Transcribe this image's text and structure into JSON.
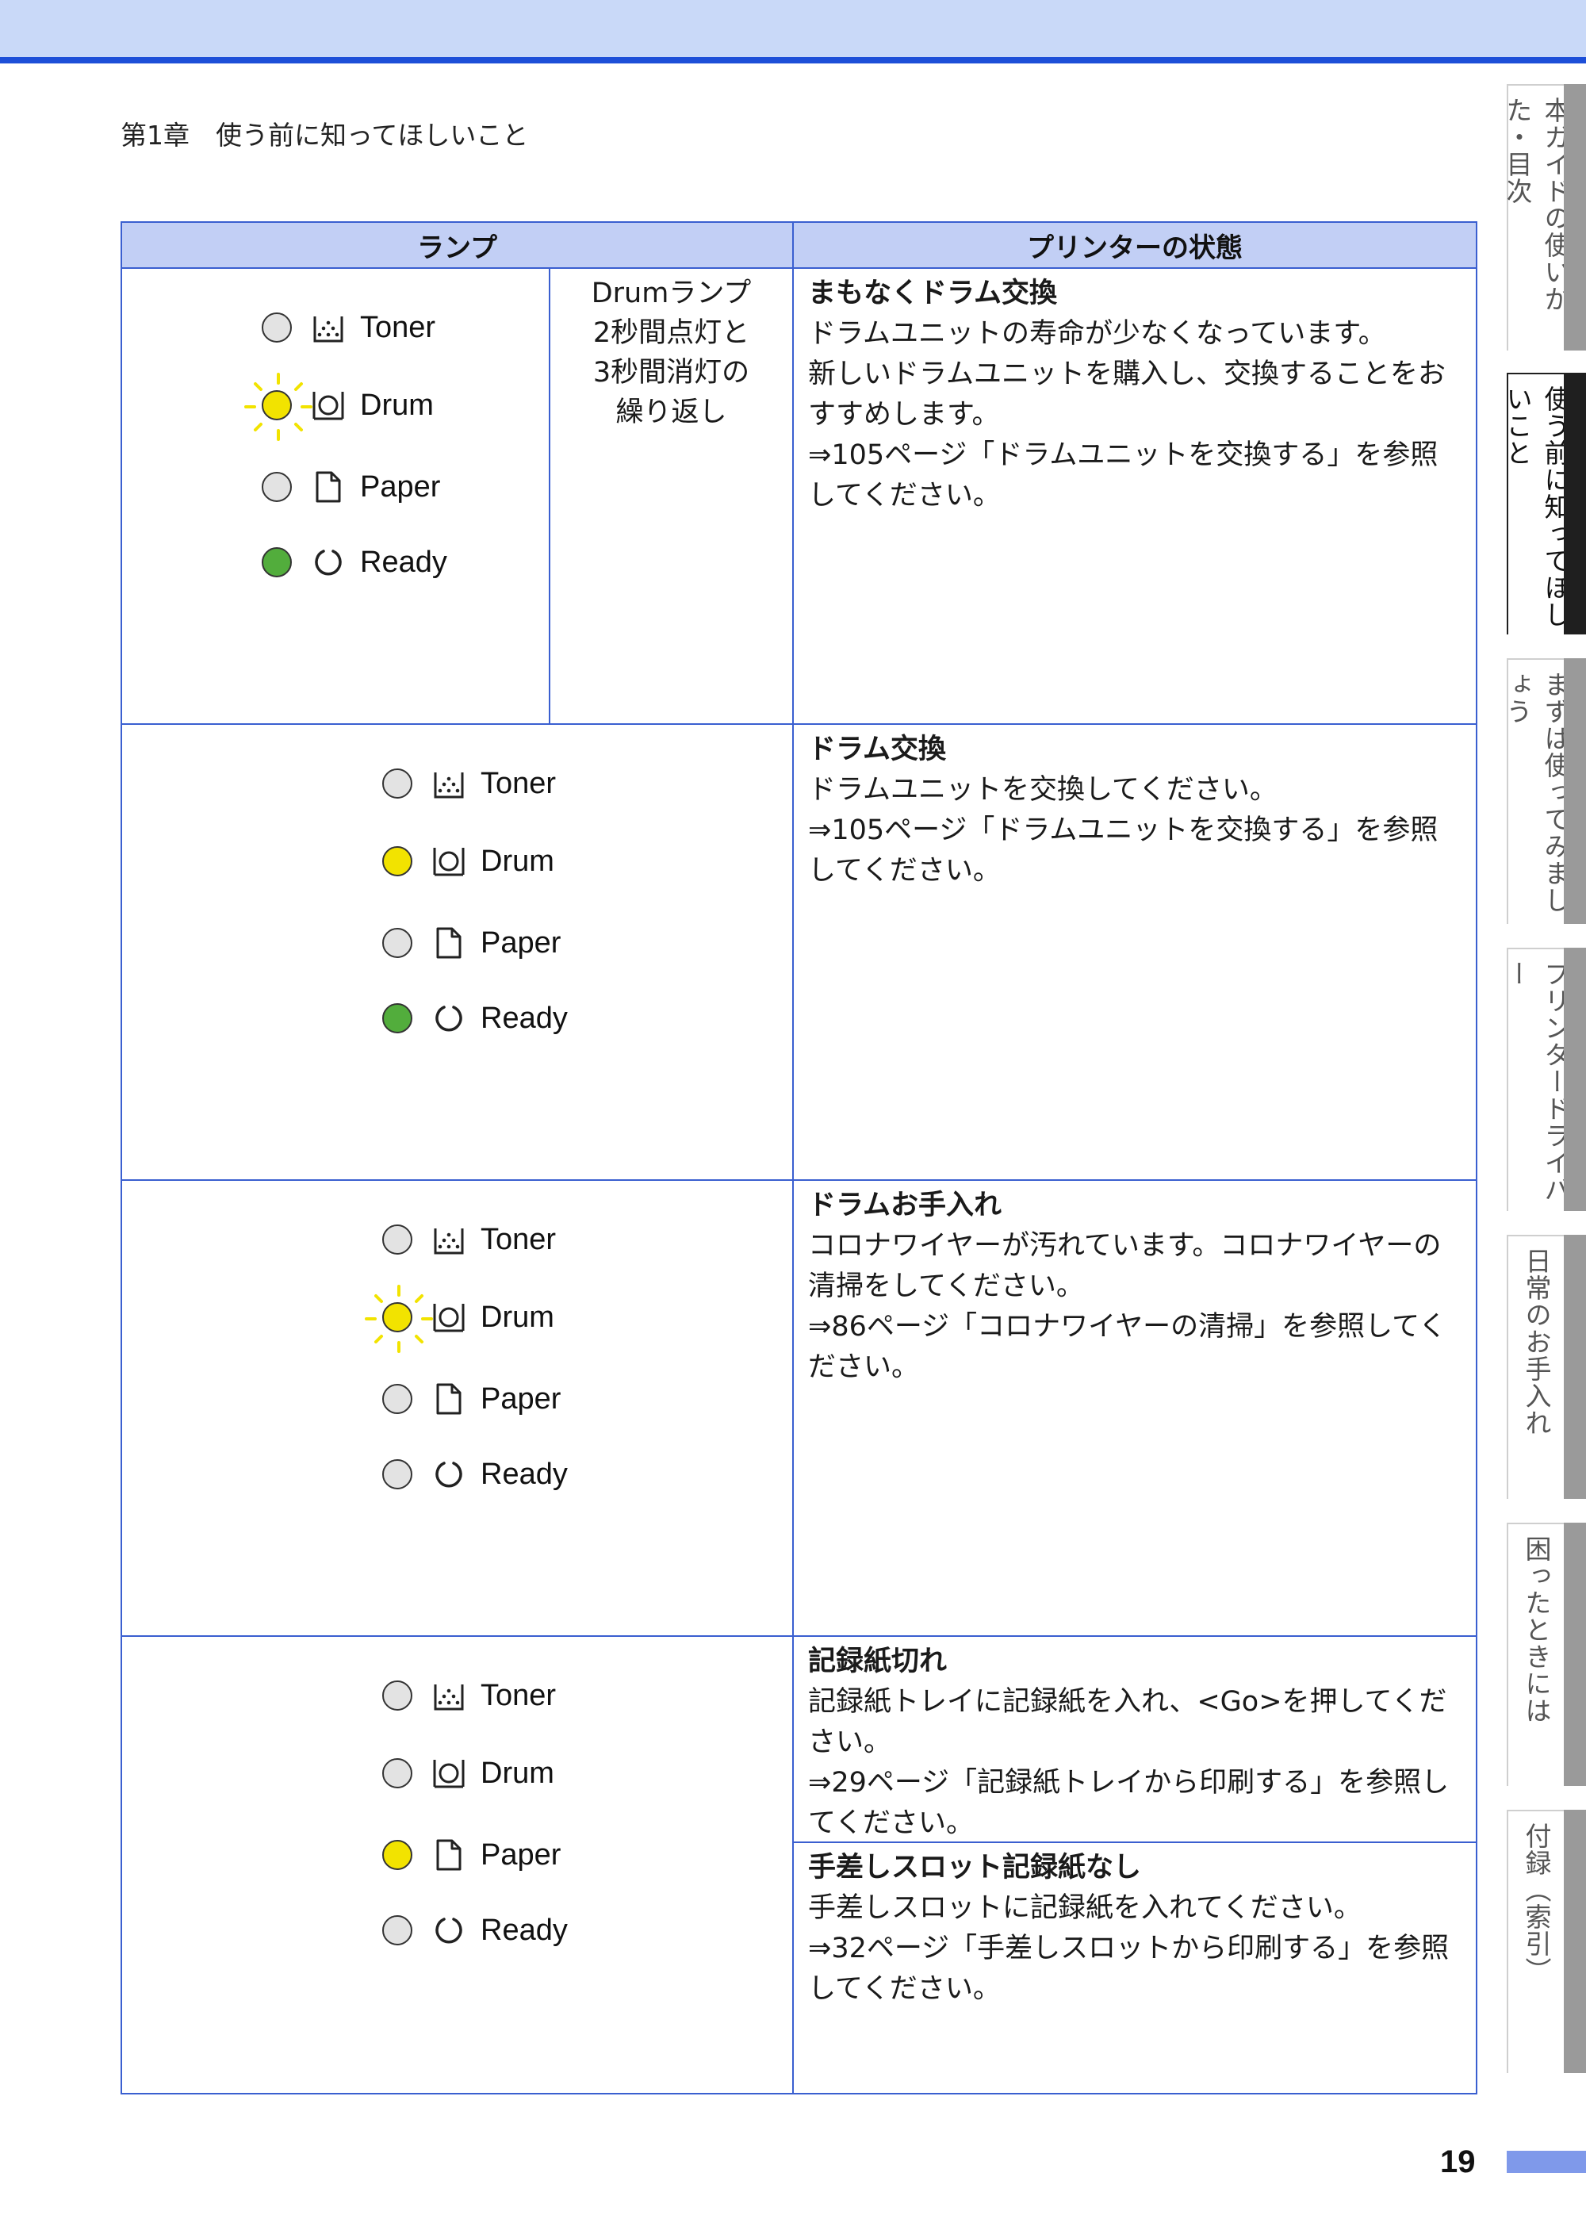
{
  "header": {
    "chapter": "第1章　使う前に知ってほしいこと"
  },
  "side_tabs": [
    {
      "label": "本ガイドの使いかた・目次",
      "active": false
    },
    {
      "label": "使う前に知ってほしいこと",
      "active": true
    },
    {
      "label": "まずは使ってみましょう",
      "active": false
    },
    {
      "label": "プリンタードライバー",
      "active": false
    },
    {
      "label": "日常のお手入れ",
      "active": false
    },
    {
      "label": "困ったときには",
      "active": false
    },
    {
      "label": "付録（索引）",
      "active": false
    }
  ],
  "table": {
    "headers": {
      "lamp": "ランプ",
      "state": "プリンターの状態"
    },
    "lamp_labels": {
      "toner": "Toner",
      "drum": "Drum",
      "paper": "Paper",
      "ready": "Ready"
    },
    "rows": [
      {
        "pattern": [
          "Drumランプ",
          "2秒間点灯と",
          "3秒間消灯の",
          "繰り返し"
        ],
        "lamps": {
          "toner": "off",
          "drum": "blink-yellow",
          "paper": "off",
          "ready": "green"
        },
        "states": [
          {
            "title": "まもなくドラム交換",
            "lines": [
              "ドラムユニットの寿命が少なくなっています。",
              "新しいドラムユニットを購入し、交換することをお",
              "すすめします。",
              "⇒105ページ「ドラムユニットを交換する」を参照",
              "してください。"
            ]
          }
        ]
      },
      {
        "lamps": {
          "toner": "off",
          "drum": "yellow",
          "paper": "off",
          "ready": "green"
        },
        "states": [
          {
            "title": "ドラム交換",
            "lines": [
              "ドラムユニットを交換してください。",
              "⇒105ページ「ドラムユニットを交換する」を参照",
              "してください。"
            ]
          }
        ]
      },
      {
        "lamps": {
          "toner": "off",
          "drum": "blink-yellow",
          "paper": "off",
          "ready": "off"
        },
        "states": [
          {
            "title": "ドラムお手入れ",
            "lines": [
              "コロナワイヤーが汚れています。コロナワイヤーの",
              "清掃をしてください。",
              "⇒86ページ「コロナワイヤーの清掃」を参照してく",
              "ださい。"
            ]
          }
        ]
      },
      {
        "lamps": {
          "toner": "off",
          "drum": "off",
          "paper": "yellow",
          "ready": "off"
        },
        "states": [
          {
            "title": "記録紙切れ",
            "lines": [
              "記録紙トレイに記録紙を入れ、<Go>を押してくだ",
              "さい。",
              "⇒29ページ「記録紙トレイから印刷する」を参照し",
              "てください。"
            ]
          },
          {
            "title": "手差しスロット記録紙なし",
            "lines": [
              "手差しスロットに記録紙を入れてください。",
              "⇒32ページ「手差しスロットから印刷する」を参照",
              "してください。"
            ]
          }
        ]
      }
    ]
  },
  "page_number": "19",
  "colors": {
    "accent": "#1d4fd8",
    "header_fill": "#c2cff5",
    "led_yellow": "#f2e300",
    "led_green": "#52ad3c",
    "led_off": "#e3e3e3"
  }
}
